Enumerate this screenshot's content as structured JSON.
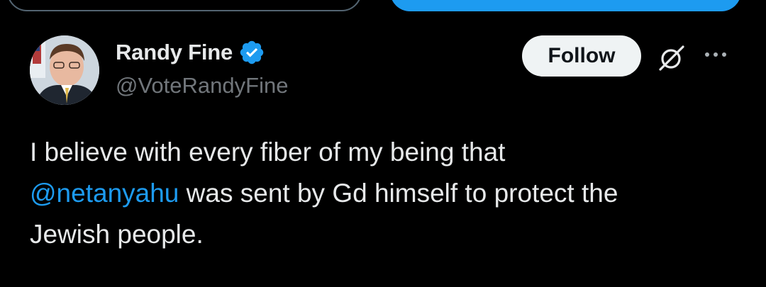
{
  "author": {
    "display_name": "Randy Fine",
    "handle": "@VoteRandyFine",
    "verified": true
  },
  "header": {
    "follow_label": "Follow",
    "grok_icon": "grok-icon",
    "more_icon": "more-options-icon"
  },
  "tweet": {
    "line1": "I believe with every fiber of my being that",
    "mention": "@netanyahu",
    "line2_rest": " was sent by Gd himself to protect the",
    "line3": "Jewish people."
  },
  "colors": {
    "background": "#000000",
    "accent": "#1d9bf0",
    "text_primary": "#e7e9ea",
    "text_secondary": "#71767b",
    "follow_bg": "#eff3f4"
  }
}
